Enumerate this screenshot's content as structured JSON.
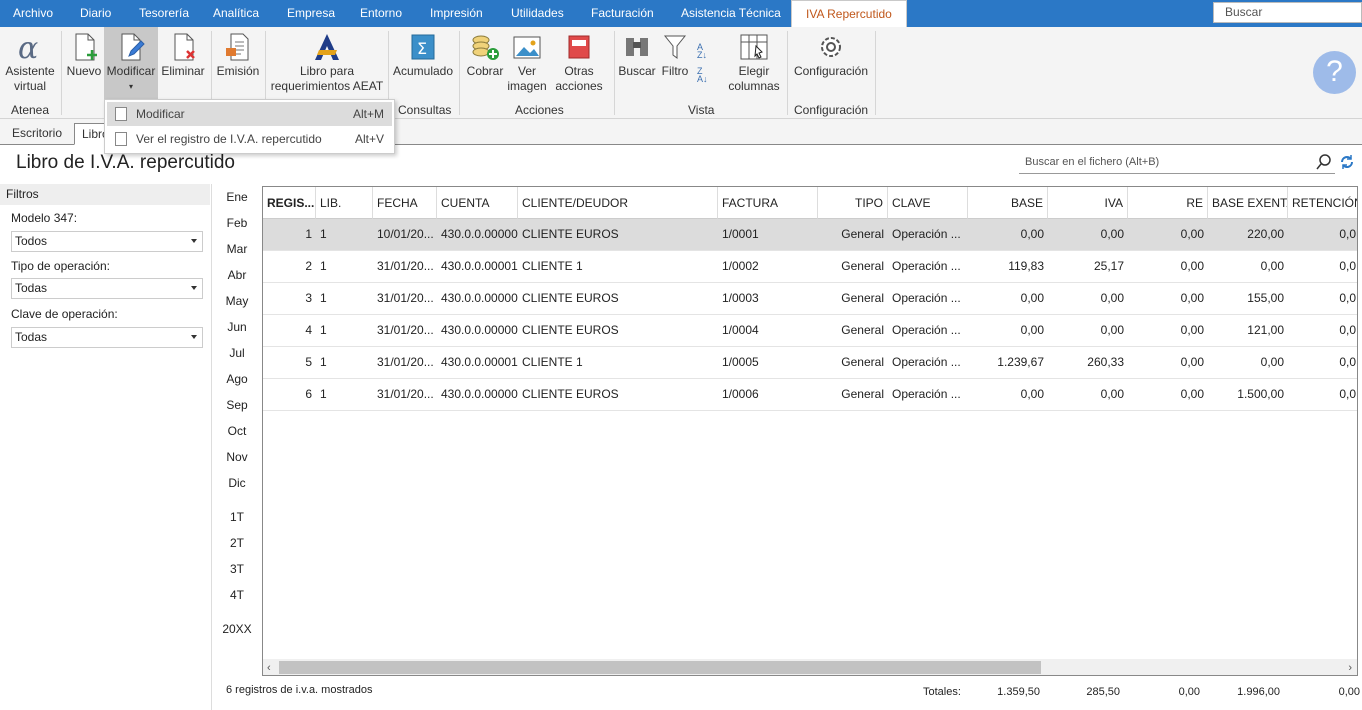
{
  "menu": {
    "tabs": [
      "Archivo",
      "Diario",
      "Tesorería",
      "Analítica",
      "Empresa",
      "Entorno",
      "Impresión",
      "Utilidades",
      "Facturación",
      "Asistencia Técnica"
    ],
    "active_tab": "IVA Repercutido",
    "search_placeholder": "Buscar"
  },
  "ribbon": {
    "asistente": "Asistente virtual",
    "nuevo": "Nuevo",
    "modificar": "Modificar",
    "eliminar": "Eliminar",
    "emision": "Emisión",
    "libro": "Libro para requerimientos AEAT",
    "acumulado": "Acumulado",
    "cobrar": "Cobrar",
    "ver_imagen": "Ver imagen",
    "otras": "Otras acciones",
    "buscar": "Buscar",
    "filtro": "Filtro",
    "elegir": "Elegir columnas",
    "configuracion": "Configuración",
    "groups": {
      "atenea": "Atenea",
      "consultas": "Consultas",
      "acciones": "Acciones",
      "vista": "Vista",
      "configuracion": "Configuración"
    }
  },
  "doc_tabs": [
    "Escritorio",
    "Libro"
  ],
  "page_title": "Libro de I.V.A. repercutido",
  "file_search_placeholder": "Buscar en el fichero (Alt+B)",
  "filters": {
    "title": "Filtros",
    "modelo_label": "Modelo 347:",
    "modelo_value": "Todos",
    "tipo_label": "Tipo de operación:",
    "tipo_value": "Todas",
    "clave_label": "Clave de operación:",
    "clave_value": "Todas"
  },
  "months": [
    "Ene",
    "Feb",
    "Mar",
    "Abr",
    "May",
    "Jun",
    "Jul",
    "Ago",
    "Sep",
    "Oct",
    "Nov",
    "Dic"
  ],
  "quarters": [
    "1T",
    "2T",
    "3T",
    "4T"
  ],
  "year": "20XX",
  "columns": [
    "REGIS...",
    "LIB.",
    "FECHA",
    "CUENTA",
    "CLIENTE/DEUDOR",
    "FACTURA",
    "TIPO",
    "CLAVE",
    "BASE",
    "IVA",
    "RE",
    "BASE EXENTA",
    "RETENCIÓN"
  ],
  "rows": [
    [
      "1",
      "1",
      "10/01/20...",
      "430.0.0.00000",
      "CLIENTE EUROS",
      "1/0001",
      "General",
      "Operación ...",
      "0,00",
      "0,00",
      "0,00",
      "220,00",
      "0,0"
    ],
    [
      "2",
      "1",
      "31/01/20...",
      "430.0.0.00001",
      "CLIENTE 1",
      "1/0002",
      "General",
      "Operación ...",
      "119,83",
      "25,17",
      "0,00",
      "0,00",
      "0,0"
    ],
    [
      "3",
      "1",
      "31/01/20...",
      "430.0.0.00000",
      "CLIENTE EUROS",
      "1/0003",
      "General",
      "Operación ...",
      "0,00",
      "0,00",
      "0,00",
      "155,00",
      "0,0"
    ],
    [
      "4",
      "1",
      "31/01/20...",
      "430.0.0.00000",
      "CLIENTE EUROS",
      "1/0004",
      "General",
      "Operación ...",
      "0,00",
      "0,00",
      "0,00",
      "121,00",
      "0,0"
    ],
    [
      "5",
      "1",
      "31/01/20...",
      "430.0.0.00001",
      "CLIENTE 1",
      "1/0005",
      "General",
      "Operación ...",
      "1.239,67",
      "260,33",
      "0,00",
      "0,00",
      "0,0"
    ],
    [
      "6",
      "1",
      "31/01/20...",
      "430.0.0.00000",
      "CLIENTE EUROS",
      "1/0006",
      "General",
      "Operación ...",
      "0,00",
      "0,00",
      "0,00",
      "1.500,00",
      "0,0"
    ]
  ],
  "status": "6 registros de i.v.a. mostrados",
  "totals": {
    "label": "Totales:",
    "base": "1.359,50",
    "iva": "285,50",
    "re": "0,00",
    "exenta": "1.996,00",
    "retencion": "0,00"
  },
  "dropdown": {
    "item1": "Modificar",
    "item1_key": "Alt+M",
    "item2": "Ver el registro de I.V.A. repercutido",
    "item2_key": "Alt+V"
  },
  "colors": {
    "menubar": "#2b78c6",
    "active_tab_text": "#c0571b",
    "help": "#9ebbe9"
  }
}
